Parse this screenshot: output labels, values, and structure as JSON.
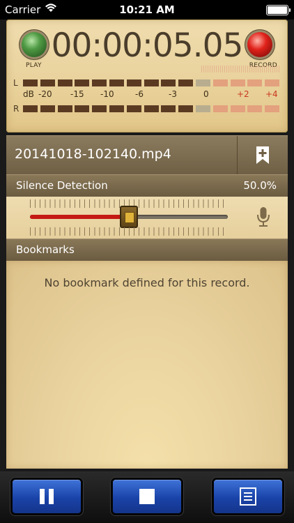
{
  "status_bar": {
    "carrier": "Carrier",
    "time": "10:21 AM"
  },
  "meter": {
    "timer": "00:00:05.05",
    "play_label": "PLAY",
    "record_label": "RECORD",
    "left_channel": "L",
    "right_channel": "R",
    "db_label": "dB",
    "db_ticks": [
      "-20",
      "-15",
      "-10",
      "-6",
      "-3",
      "0",
      "+2",
      "+4"
    ]
  },
  "track": {
    "filename": "20141018-102140.mp4"
  },
  "silence": {
    "label": "Silence Detection",
    "value": "50.0%",
    "level": 0.5
  },
  "bookmarks": {
    "label": "Bookmarks",
    "empty_message": "No bookmark defined for this record."
  },
  "icons": {
    "bookmark_add": "bookmark-plus-icon",
    "mic": "microphone-icon",
    "pause": "pause-icon",
    "stop": "stop-icon",
    "list": "list-icon"
  },
  "colors": {
    "accent_blue": "#2a59c4",
    "record_red": "#e0221a",
    "play_green": "#4f9a44",
    "panel_tan": "#e9d29c"
  }
}
